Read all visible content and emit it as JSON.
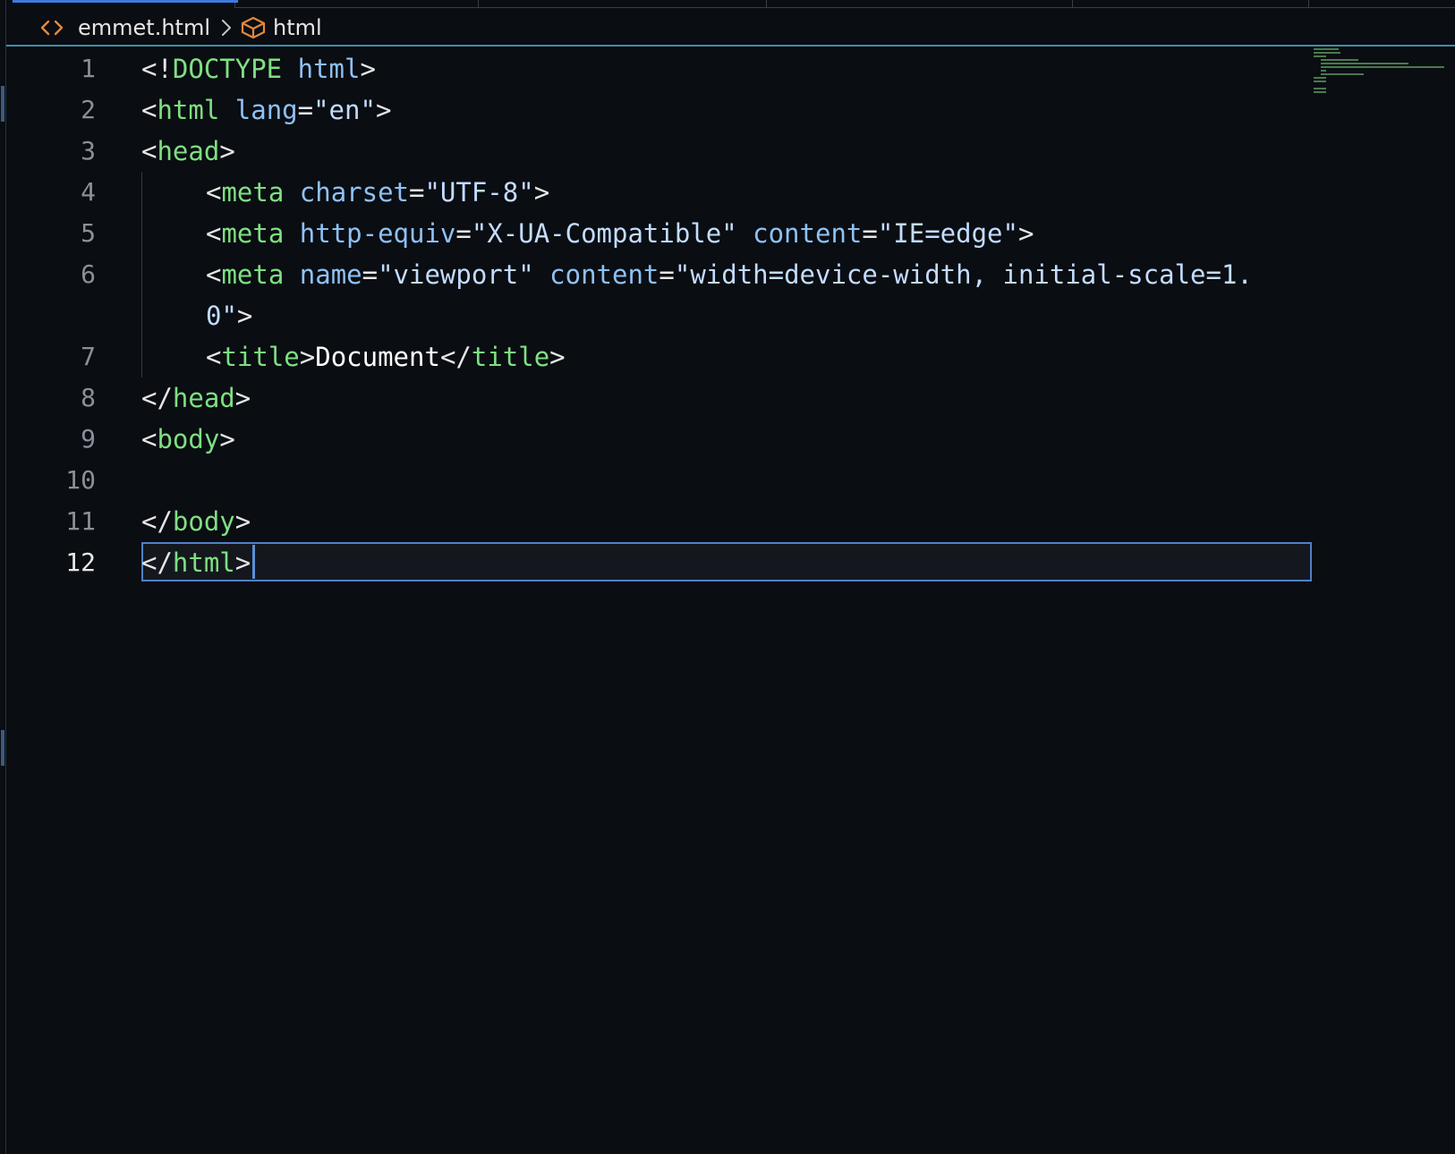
{
  "breadcrumb": {
    "file_icon": "code-brackets-icon",
    "file_name": "emmet.html",
    "separator_icon": "chevron-right-icon",
    "symbol_icon": "cube-icon",
    "symbol_name": "html"
  },
  "colors": {
    "background": "#0a0d12",
    "tag": "#7ee081",
    "attribute": "#8fc1f5",
    "string": "#c3dcff",
    "punctuation": "#e6e6e6",
    "accent": "#3d7be0",
    "file_icon": "#e08a3c"
  },
  "line_numbers": [
    "1",
    "2",
    "3",
    "4",
    "5",
    "6",
    "7",
    "8",
    "9",
    "10",
    "11",
    "12"
  ],
  "active_line": "12",
  "code": {
    "l1": {
      "a": "<!",
      "b": "DOCTYPE",
      "c": " ",
      "d": "html",
      "e": ">"
    },
    "l2": {
      "a": "<",
      "b": "html",
      "c": " ",
      "d": "lang",
      "e": "=",
      "f": "\"en\"",
      "g": ">"
    },
    "l3": {
      "a": "<",
      "b": "head",
      "c": ">"
    },
    "l4": {
      "a": "<",
      "b": "meta",
      "c": " ",
      "d": "charset",
      "e": "=",
      "f": "\"UTF-8\"",
      "g": ">"
    },
    "l5": {
      "a": "<",
      "b": "meta",
      "c": " ",
      "d": "http-equiv",
      "e": "=",
      "f": "\"X-UA-Compatible\"",
      "g": " ",
      "h": "content",
      "i": "=",
      "j": "\"IE=edge\"",
      "k": ">"
    },
    "l6": {
      "a": "<",
      "b": "meta",
      "c": " ",
      "d": "name",
      "e": "=",
      "f": "\"viewport\"",
      "g": " ",
      "h": "content",
      "i": "=",
      "j": "\"width=device-width, initial-scale=1."
    },
    "l6w": {
      "a": "0\"",
      "b": ">"
    },
    "l7": {
      "a": "<",
      "b": "title",
      "c": ">",
      "d": "Document",
      "e": "</",
      "f": "title",
      "g": ">"
    },
    "l8": {
      "a": "</",
      "b": "head",
      "c": ">"
    },
    "l9": {
      "a": "<",
      "b": "body",
      "c": ">"
    },
    "l11": {
      "a": "</",
      "b": "body",
      "c": ">"
    },
    "l12": {
      "a": "</",
      "b": "html",
      "c": ">"
    }
  }
}
